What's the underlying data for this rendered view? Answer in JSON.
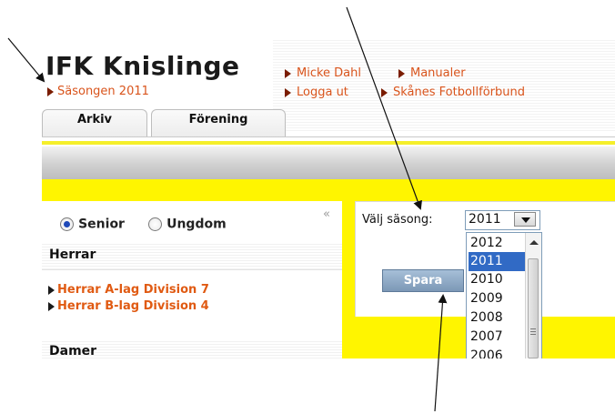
{
  "header": {
    "club_name": "IFK Knislinge",
    "season_link": "Säsongen 2011",
    "links": [
      "Micke Dahl",
      "Manualer",
      "Logga ut",
      "Skånes Fotbollförbund"
    ]
  },
  "tabs": [
    {
      "label": "Arkiv"
    },
    {
      "label": "Förening"
    }
  ],
  "sidebar": {
    "collapse_icon": "«",
    "filter": {
      "options": [
        {
          "label": "Senior",
          "selected": true
        },
        {
          "label": "Ungdom",
          "selected": false
        }
      ]
    },
    "sections": [
      {
        "title": "Herrar",
        "teams": [
          "Herrar A-lag Division 7",
          "Herrar B-lag Division 4"
        ]
      },
      {
        "title": "Damer",
        "teams": []
      }
    ]
  },
  "season_form": {
    "label": "Välj säsong:",
    "selected": "2011",
    "options": [
      "2012",
      "2011",
      "2010",
      "2009",
      "2008",
      "2007",
      "2006"
    ],
    "save_label": "Spara"
  },
  "colors": {
    "accent_link": "#d9541c",
    "highlight_yellow": "#fff500",
    "select_highlight": "#316ac5",
    "button": "#8aa5c2"
  }
}
